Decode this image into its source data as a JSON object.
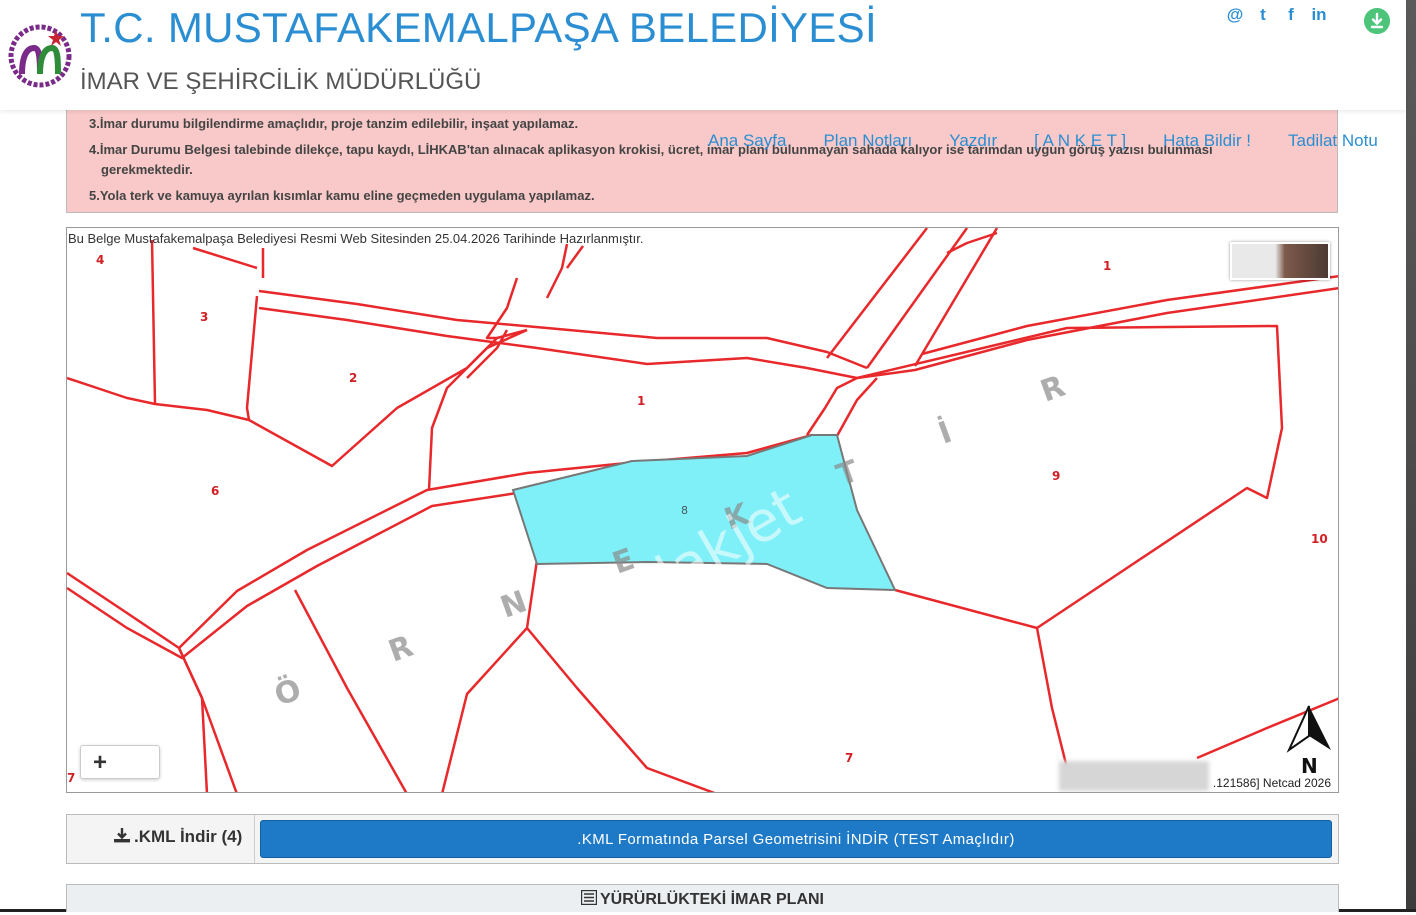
{
  "header": {
    "title": "T.C. MUSTAFAKEMALPAŞA BELEDİYESİ",
    "subtitle": "İMAR VE ŞEHİRCİLİK MÜDÜRLÜĞÜ",
    "social": [
      "@",
      "t",
      "f",
      "in"
    ]
  },
  "nav": {
    "items": [
      "Ana Sayfa",
      "Plan Notları",
      "Yazdır",
      "[ A N K E T ]",
      "Hata Bildir !",
      "Tadilat Notu"
    ]
  },
  "warning": {
    "lines": [
      "3.İmar durumu bilgilendirme amaçlıdır, proje tanzim edilebilir, inşaat yapılamaz.",
      "4.İmar Durumu Belgesi talebinde dilekçe, tapu kaydı, LİHKAB'tan alınacak aplikasyon krokisi, ücret, imar planı bulunmayan sahada kalıyor ise tarımdan uygun görüş yazısı bulunması",
      "gerekmektedir.",
      "5.Yola terk ve kamuya ayrılan kısımlar kamu eline geçmeden uygulama yapılamaz."
    ]
  },
  "map": {
    "note": "Bu Belge Mustafakemalpaşa Belediyesi Resmi Web Sitesinden 25.04.2026 Tarihinde Hazırlanmıştır.",
    "parcel_labels": [
      "4",
      "3",
      "2",
      "1",
      "6",
      "8",
      "9",
      "10",
      "7",
      "7",
      "1"
    ],
    "watermark_letters": [
      "Ö",
      "R",
      "N",
      "E",
      "K",
      "T",
      "İ",
      "R"
    ],
    "watermark_overlay": "emlakjet",
    "north_label": "N",
    "zoom_in_label": "+",
    "credit": ".121586] Netcad 2026",
    "selected_parcel_color": "#7ff0f8",
    "parcel_line_color": "#e8282b"
  },
  "kml": {
    "label": ".KML İndir (4)",
    "button": ".KML Formatında Parsel Geometrisini İNDİR (TEST Amaçlıdır)"
  },
  "plan": {
    "label": "YÜRÜRLÜKTEKİ İMAR PLANI"
  },
  "colors": {
    "brand": "#2b8ed3",
    "button": "#1e7ac6",
    "warning_bg": "#f8c9c8"
  }
}
